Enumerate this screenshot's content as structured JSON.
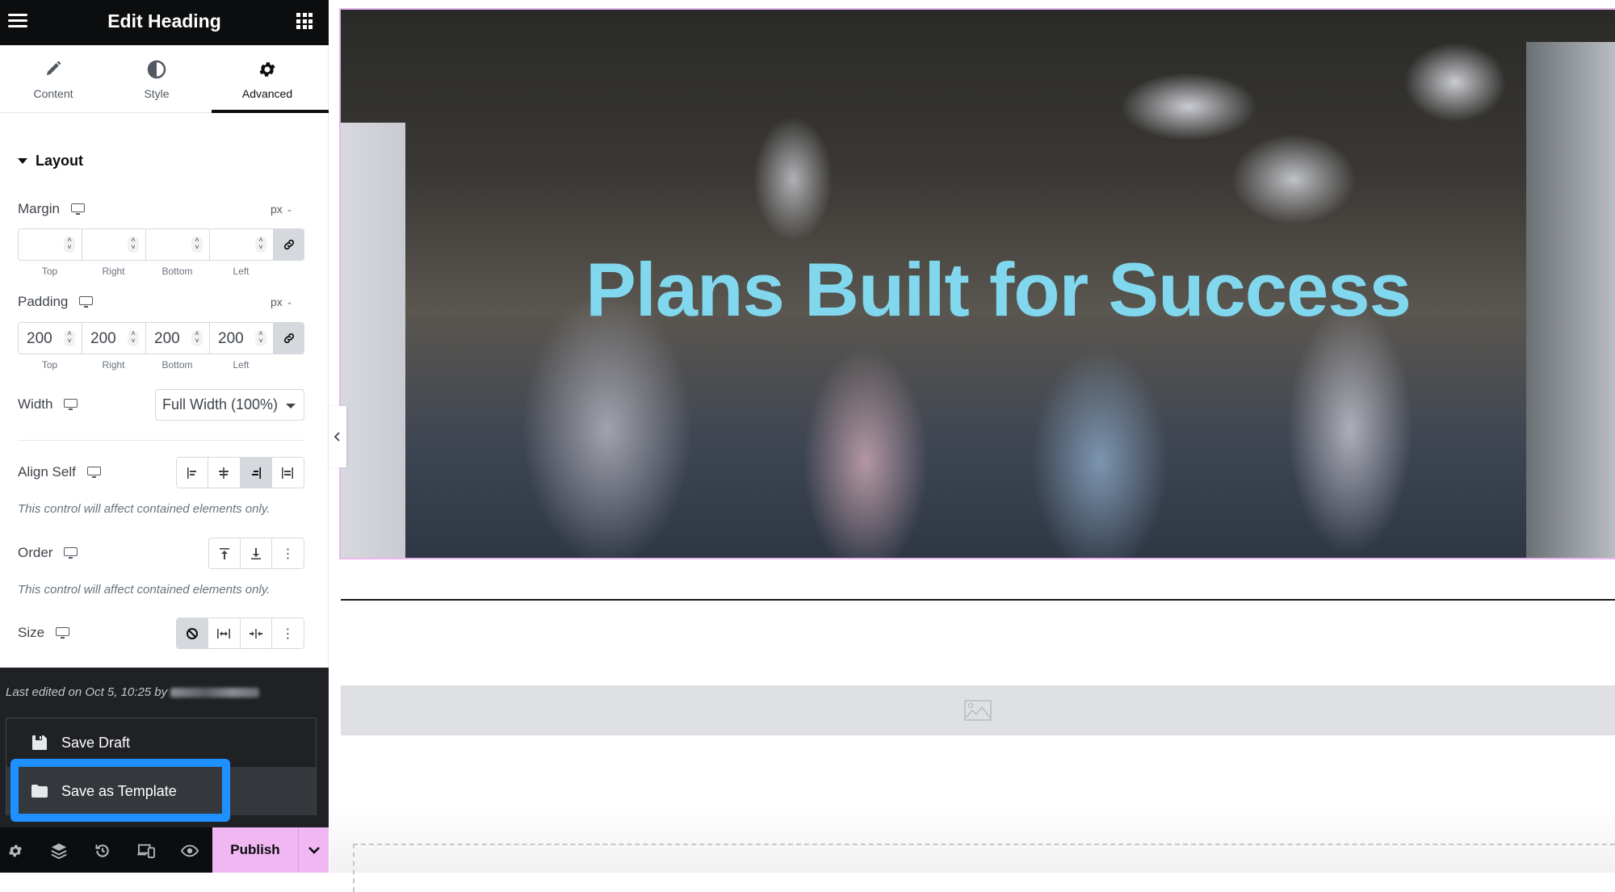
{
  "header": {
    "title": "Edit Heading",
    "menu_icon": "hamburger-icon",
    "apps_icon": "grid-icon"
  },
  "tabs": [
    {
      "label": "Content",
      "icon": "pencil-icon",
      "active": false
    },
    {
      "label": "Style",
      "icon": "half-circle-icon",
      "active": false
    },
    {
      "label": "Advanced",
      "icon": "gear-icon",
      "active": true
    }
  ],
  "section": {
    "title": "Layout",
    "margin": {
      "label": "Margin",
      "unit": "px",
      "values": {
        "top": "",
        "right": "",
        "bottom": "",
        "left": ""
      },
      "sublabels": [
        "Top",
        "Right",
        "Bottom",
        "Left"
      ]
    },
    "padding": {
      "label": "Padding",
      "unit": "px",
      "values": {
        "top": "200",
        "right": "200",
        "bottom": "200",
        "left": "200"
      },
      "sublabels": [
        "Top",
        "Right",
        "Bottom",
        "Left"
      ]
    },
    "width": {
      "label": "Width",
      "selected": "Full Width (100%)"
    },
    "align_self": {
      "label": "Align Self",
      "options": [
        "Start",
        "Center",
        "End",
        "Stretch"
      ],
      "selected": "End",
      "note": "This control will affect contained elements only."
    },
    "order": {
      "label": "Order",
      "options": [
        "Start",
        "End",
        "Custom"
      ],
      "note": "This control will affect contained elements only."
    },
    "size": {
      "label": "Size",
      "options": [
        "None",
        "Grow",
        "Shrink",
        "Custom"
      ],
      "selected": "None"
    }
  },
  "footer_panel": {
    "last_edited": "Last edited on Oct 5, 10:25 by",
    "menu": [
      {
        "label": "Save Draft",
        "icon": "floppy-disk-icon"
      },
      {
        "label": "Save as Template",
        "icon": "folder-icon",
        "highlighted": true
      }
    ]
  },
  "bottom_bar": {
    "icons": [
      "settings-icon",
      "layers-icon",
      "history-icon",
      "responsive-icon",
      "preview-eye-icon"
    ],
    "publish_label": "Publish"
  },
  "canvas": {
    "heading": "Plans Built for Success",
    "heading_color": "#81d8ee",
    "selection_color": "#e8b7ef"
  },
  "colors": {
    "highlight": "#1e90ff",
    "publish_bg": "#f0b7f3"
  }
}
